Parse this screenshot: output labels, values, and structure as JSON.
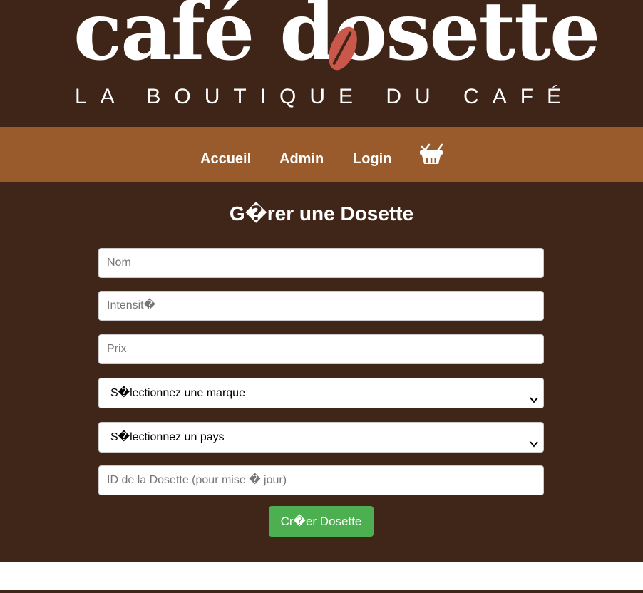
{
  "brand": {
    "logo_text": "café dosette",
    "tagline": "LA BOUTIQUE DU CAFÉ",
    "colors": {
      "header_bg": "#3f2418",
      "nav_bg": "#9a5b2c",
      "bean": "#c9574a",
      "button": "#4caf50"
    }
  },
  "nav": {
    "items": [
      {
        "label": "Accueil"
      },
      {
        "label": "Admin"
      },
      {
        "label": "Login"
      }
    ],
    "cart_icon": "shopping-basket-icon"
  },
  "form": {
    "title": "G�rer une Dosette",
    "name_placeholder": "Nom",
    "intensity_placeholder": "Intensit�",
    "price_placeholder": "Prix",
    "brand_select": "S�lectionnez une marque",
    "country_select": "S�lectionnez un pays",
    "id_placeholder": "ID de la Dosette (pour mise � jour)",
    "submit_label": "Cr�er Dosette"
  }
}
